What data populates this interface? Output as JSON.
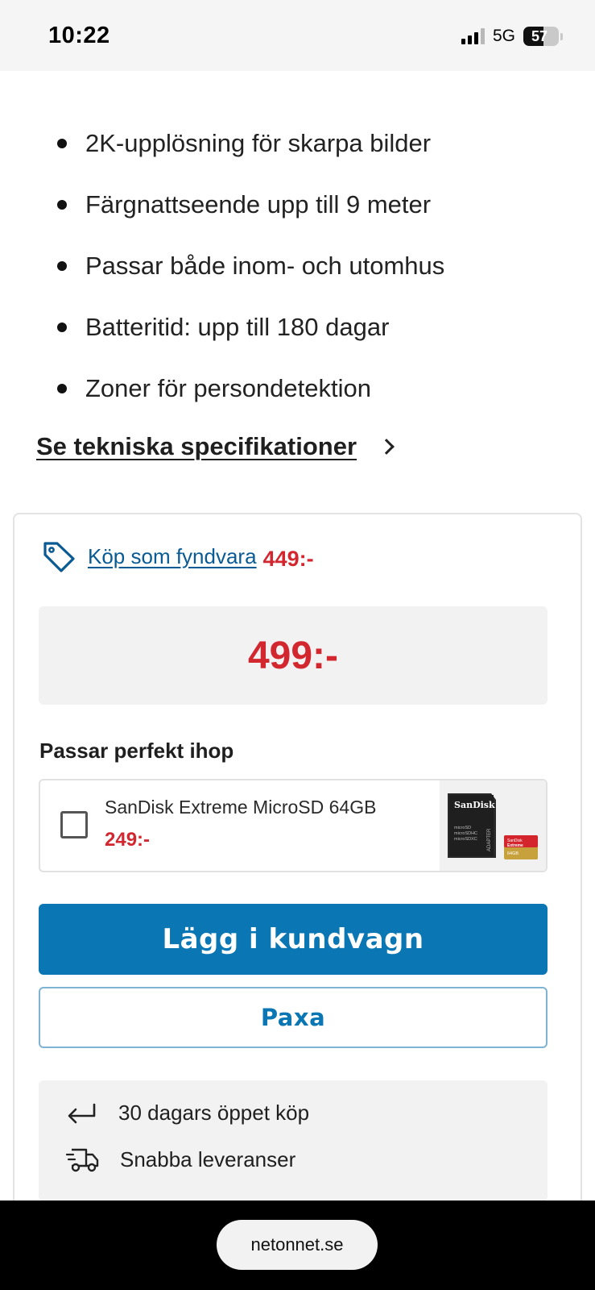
{
  "status_bar": {
    "time": "10:22",
    "network": "5G",
    "battery_percent": "57",
    "battery_level": 0.57
  },
  "features": [
    "2K-upplösning för skarpa bilder",
    "Färgnattseende upp till 9 meter",
    "Passar både inom- och utomhus",
    "Batteritid: upp till 180 dagar",
    "Zoner för persondetektion"
  ],
  "spec_link": "Se tekniska specifikationer",
  "card": {
    "fynd_link": "Köp som fyndvara",
    "fynd_price": "449:-",
    "price": "499:-",
    "combo_title": "Passar perfekt ihop",
    "combo_item": {
      "name": "SanDisk Extreme MicroSD 64GB",
      "price": "249:-",
      "checked": false,
      "image": {
        "brand": "SanDisk",
        "adapter_lines": [
          "microSD",
          "microSDHC",
          "microSDXC"
        ],
        "adapter_label": "ADAPTER",
        "card_brand": "SanDisk",
        "card_line": "Extreme",
        "card_capacity": "64GB"
      }
    },
    "add_to_cart": "Lägg i kundvagn",
    "paxa": "Paxa",
    "perks": [
      {
        "icon": "return-arrow-icon",
        "text": "30 dagars öppet köp"
      },
      {
        "icon": "delivery-truck-icon",
        "text": "Snabba leveranser"
      }
    ]
  },
  "browser": {
    "url": "netonnet.se"
  },
  "colors": {
    "price_red": "#d3272f",
    "primary_blue": "#0a77b4",
    "link_blue": "#0a5b93"
  }
}
